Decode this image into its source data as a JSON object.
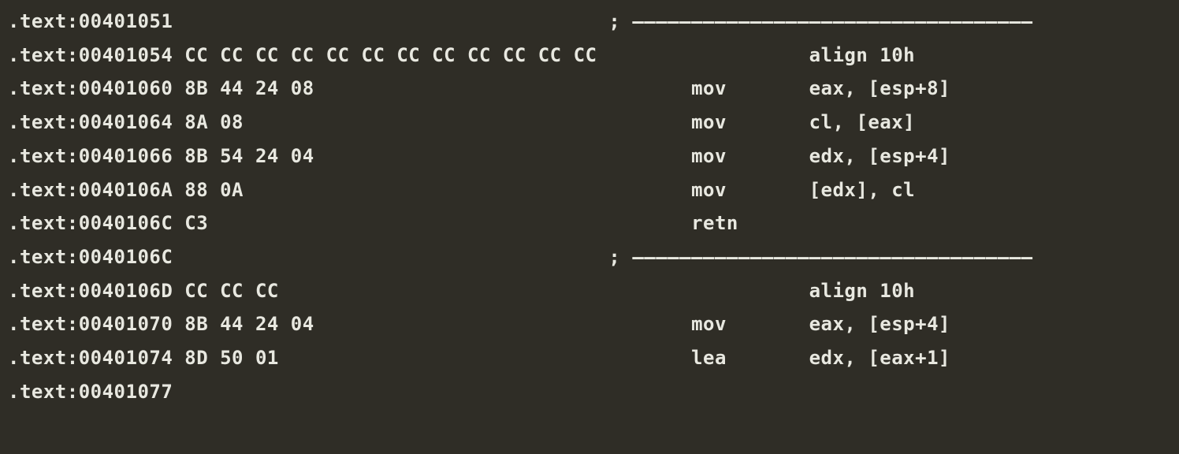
{
  "disassembly": {
    "segment_prefix": ".text:",
    "separator_prefix": "; ",
    "separator_dashes": "——————————————————————————————————",
    "columns": {
      "bytes_start": 15,
      "comment_col": 51,
      "mnemonic_col": 58,
      "operand_col": 68
    },
    "lines": [
      {
        "addr": "00401051",
        "bytes": "",
        "mnemonic": "",
        "operands": "",
        "separator": true
      },
      {
        "addr": "00401054",
        "bytes": "CC CC CC CC CC CC CC CC CC CC CC CC",
        "mnemonic": "",
        "operands": "align 10h",
        "separator": false
      },
      {
        "addr": "00401060",
        "bytes": "8B 44 24 08",
        "mnemonic": "mov",
        "operands": "eax, [esp+8]",
        "separator": false
      },
      {
        "addr": "00401064",
        "bytes": "8A 08",
        "mnemonic": "mov",
        "operands": "cl, [eax]",
        "separator": false
      },
      {
        "addr": "00401066",
        "bytes": "8B 54 24 04",
        "mnemonic": "mov",
        "operands": "edx, [esp+4]",
        "separator": false
      },
      {
        "addr": "0040106A",
        "bytes": "88 0A",
        "mnemonic": "mov",
        "operands": "[edx], cl",
        "separator": false
      },
      {
        "addr": "0040106C",
        "bytes": "C3",
        "mnemonic": "retn",
        "operands": "",
        "separator": false
      },
      {
        "addr": "0040106C",
        "bytes": "",
        "mnemonic": "",
        "operands": "",
        "separator": true
      },
      {
        "addr": "0040106D",
        "bytes": "CC CC CC",
        "mnemonic": "",
        "operands": "align 10h",
        "separator": false
      },
      {
        "addr": "00401070",
        "bytes": "8B 44 24 04",
        "mnemonic": "mov",
        "operands": "eax, [esp+4]",
        "separator": false
      },
      {
        "addr": "00401074",
        "bytes": "8D 50 01",
        "mnemonic": "lea",
        "operands": "edx, [eax+1]",
        "separator": false
      },
      {
        "addr": "00401077",
        "bytes": "",
        "mnemonic": "",
        "operands": "",
        "separator": false
      }
    ]
  }
}
